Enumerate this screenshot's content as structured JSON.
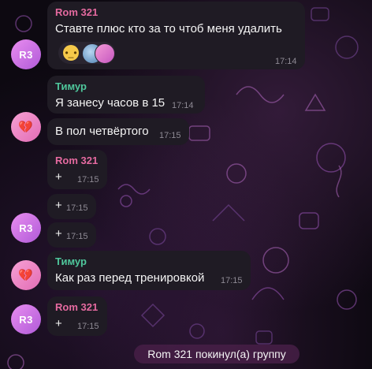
{
  "colors": {
    "rom_name": "#e56aa0",
    "timur_name": "#4fc79c",
    "bubble": "#1f1b24",
    "time": "#8e8a94"
  },
  "messages": [
    {
      "sender": "Rom 321",
      "text": "Ставте плюс кто за то чтоб меня удалить",
      "time": "17:14",
      "reactions": [
        "neutral-face-emoji",
        "user-avatar",
        "user-avatar"
      ]
    },
    {
      "sender": "Тимур",
      "text": "Я занесу часов в 15",
      "time": "17:14"
    },
    {
      "text": "В пол четвёртого",
      "time": "17:15"
    },
    {
      "sender": "Rom 321",
      "text": "+",
      "time": "17:15"
    },
    {
      "text": "+",
      "time": "17:15"
    },
    {
      "text": "+",
      "time": "17:15"
    },
    {
      "sender": "Тимур",
      "text": "Как раз перед тренировкой",
      "time": "17:15"
    },
    {
      "sender": "Rom 321",
      "text": "+",
      "time": "17:15"
    }
  ],
  "avatars": {
    "rom_initials": "R3",
    "timur_icon": "heart-icon",
    "heart_glyph": "💔"
  },
  "service_message": "Rom 321 покинул(а) группу"
}
